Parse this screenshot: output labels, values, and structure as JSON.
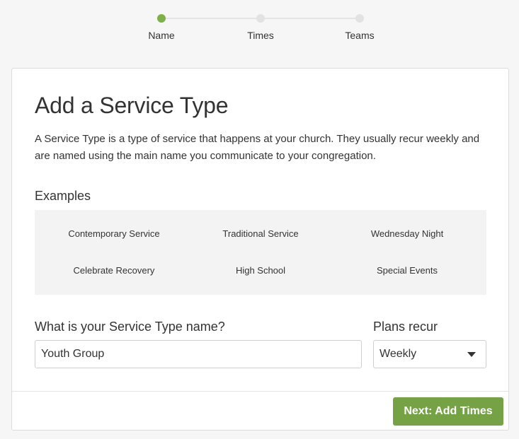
{
  "stepper": {
    "steps": [
      {
        "label": "Name",
        "active": true
      },
      {
        "label": "Times",
        "active": false
      },
      {
        "label": "Teams",
        "active": false
      }
    ],
    "active_color": "#7eb04a",
    "inactive_color": "#e2e2e2"
  },
  "form": {
    "title": "Add a Service Type",
    "intro": "A Service Type is a type of service that happens at your church. They usually recur weekly and are named using the main name you communicate to your congregation.",
    "examples_heading": "Examples",
    "examples": [
      "Contemporary Service",
      "Traditional Service",
      "Wednesday Night",
      "Celebrate Recovery",
      "High School",
      "Special Events"
    ],
    "name_label": "What is your Service Type name?",
    "name_value": "Youth Group",
    "recur_label": "Plans recur",
    "recur_value": "Weekly",
    "next_button": "Next: Add Times",
    "button_color": "#74a244"
  }
}
